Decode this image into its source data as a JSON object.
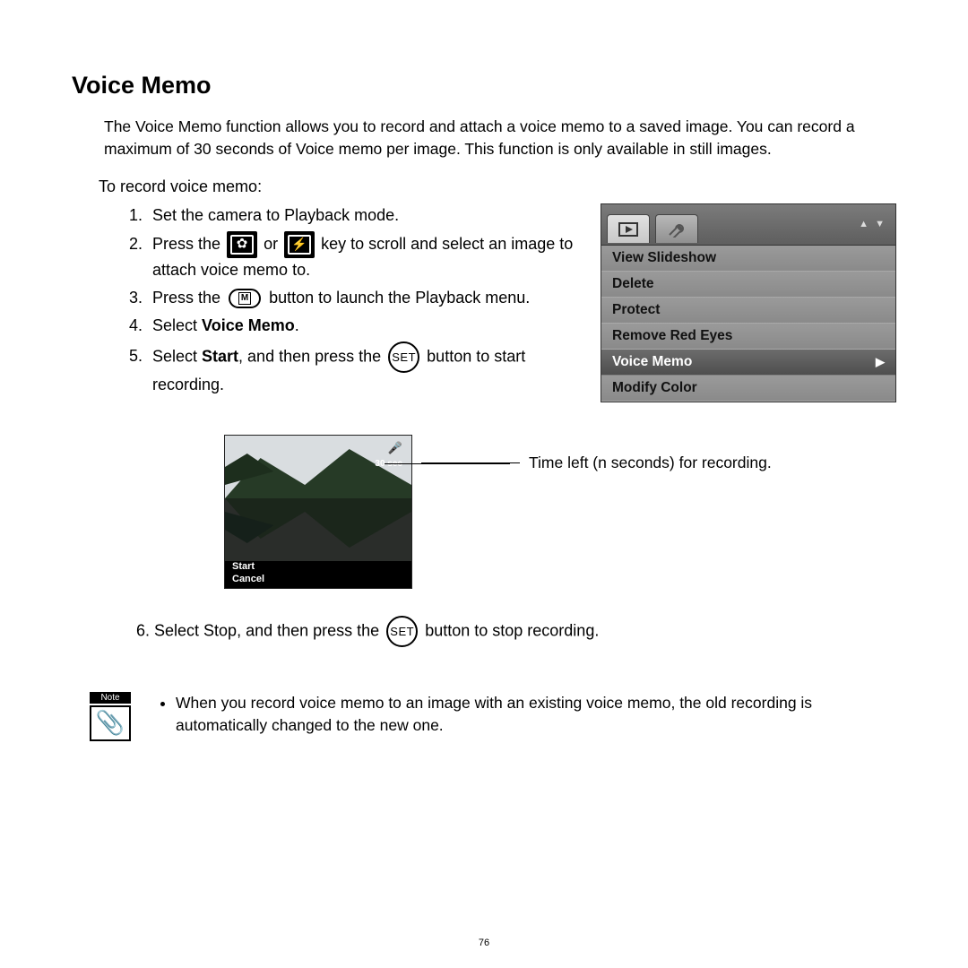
{
  "title": "Voice Memo",
  "intro": "The Voice Memo function allows you to record and attach a voice memo to a saved image. You can record a maximum of 30 seconds of Voice memo per image. This function is only available in still images.",
  "lead": "To record voice memo:",
  "steps": {
    "s1": "Set the camera to Playback mode.",
    "s2a": "Press the ",
    "s2b": " or ",
    "s2c": " key to scroll and select an image to attach voice memo to.",
    "s3a": "Press the ",
    "s3b": " button to launch the Playback menu.",
    "s4a": "Select ",
    "s4b": "Voice Memo",
    "s4c": ".",
    "s5a": "Select ",
    "s5b": "Start",
    "s5c": ", and then press the ",
    "s5d": " button to start recording.",
    "s6a": "6.   Select Stop, and then press the ",
    "s6b": " button to stop recording."
  },
  "set_label": "SET",
  "menu": {
    "updn": "▲  ▼",
    "items": {
      "i0": "View Slideshow",
      "i1": "Delete",
      "i2": "Protect",
      "i3": "Remove Red Eyes",
      "i4": "Voice Memo",
      "i5": "Modify Color"
    },
    "arrow": "▶"
  },
  "lcd": {
    "time": "30 sec",
    "opt1": "Start",
    "opt2": "Cancel"
  },
  "caption": "Time left (n seconds) for recording.",
  "note_label": "Note",
  "note_body": "When you record voice memo to an image with an existing voice memo, the old recording is automatically changed to the new one.",
  "page": "76"
}
